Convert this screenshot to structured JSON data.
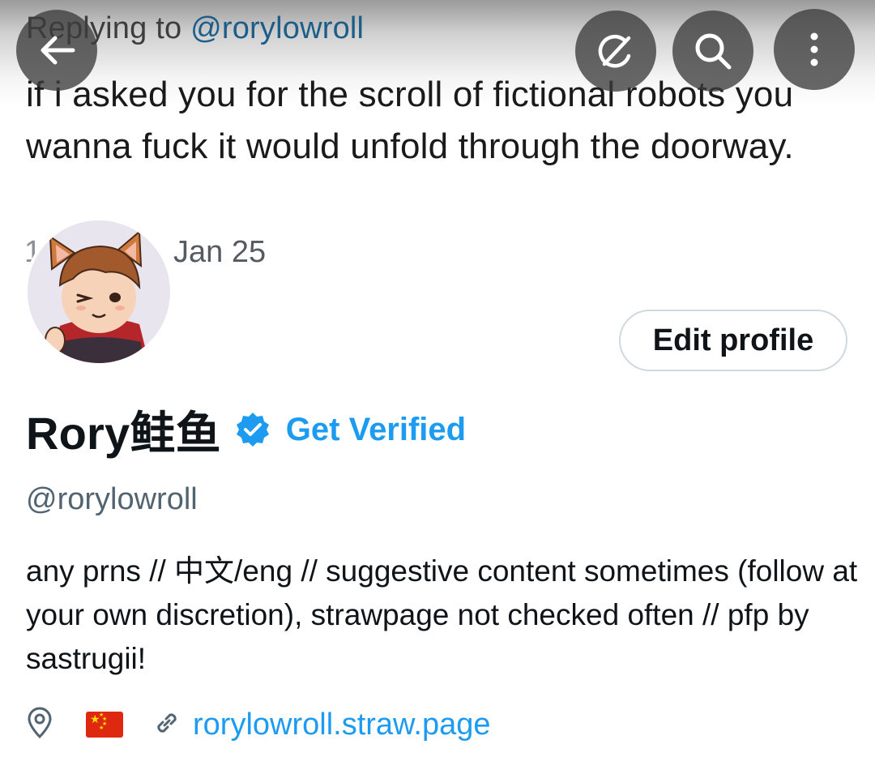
{
  "pinned_tweet": {
    "replying_prefix": "Replying to ",
    "replying_handle": "@rorylowroll",
    "text": "if i asked you for the scroll of fictional robots you wanna fuck it would unfold through the doorway.",
    "date_prefix": "1:00",
    "date": "Jan 25"
  },
  "nav": {
    "back_icon": "arrow-left-icon",
    "grok_icon": "grok-icon",
    "search_icon": "search-icon",
    "more_icon": "more-vertical-icon"
  },
  "profile": {
    "display_name": "Rory鲑鱼",
    "verified_badge_color": "#1d9bf0",
    "get_verified_label": "Get Verified",
    "username": "@rorylowroll",
    "edit_profile_label": "Edit profile",
    "bio": "any prns // 中文/eng // suggestive content sometimes (follow at your own discretion), strawpage not checked often // pfp by sastrugii!",
    "location_icon": "location-pin-icon",
    "location_flag": "china-flag",
    "website": "rorylowroll.straw.page"
  },
  "colors": {
    "accent": "#1d9bf0",
    "text": "#0f1419",
    "secondary_text": "#536471"
  }
}
